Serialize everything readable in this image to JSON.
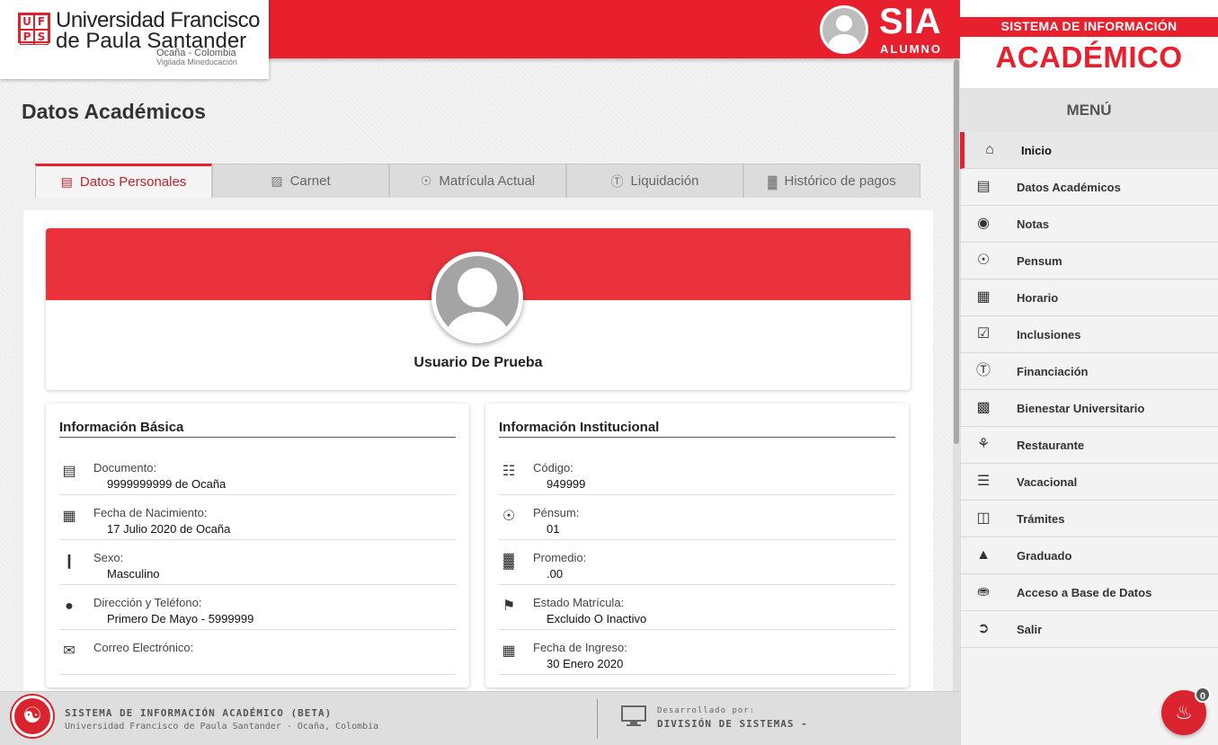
{
  "header": {
    "university_name_line1": "Universidad Francisco",
    "university_name_line2": "de Paula Santander",
    "university_city": "Ocaña - Colombia",
    "university_vigilance": "Vigilada Mineducación",
    "logo_letters": [
      "U",
      "F",
      "P",
      "S"
    ],
    "app_title": "SIA",
    "app_subtitle": "ALUMNO",
    "accent_color": "#e8202e"
  },
  "page": {
    "title": "Datos Académicos"
  },
  "tabs": [
    {
      "label": "Datos Personales",
      "icon": "id-card-icon"
    },
    {
      "label": "Carnet",
      "icon": "badge-icon"
    },
    {
      "label": "Matrícula Actual",
      "icon": "sitemap-icon"
    },
    {
      "label": "Liquidación",
      "icon": "dollar-icon"
    },
    {
      "label": "Histórico de pagos",
      "icon": "bar-chart-icon"
    }
  ],
  "profile": {
    "name": "Usuario De Prueba"
  },
  "basic_info": {
    "title": "Información Básica",
    "rows": [
      {
        "label": "Documento:",
        "value": "9999999999 de Ocaña",
        "icon": "credit-card-icon"
      },
      {
        "label": "Fecha de Nacimiento:",
        "value": "17 Julio 2020 de Ocaña",
        "icon": "calendar-icon"
      },
      {
        "label": "Sexo:",
        "value": "Masculino",
        "icon": "person-icon"
      },
      {
        "label": "Dirección y Teléfono:",
        "value": "Primero De Mayo - 5999999",
        "icon": "map-pin-icon"
      },
      {
        "label": "Correo Electrónico:",
        "value": "",
        "icon": "envelope-icon"
      }
    ]
  },
  "institutional_info": {
    "title": "Información Institucional",
    "rows": [
      {
        "label": "Código:",
        "value": "949999",
        "icon": "barcode-icon"
      },
      {
        "label": "Pénsum:",
        "value": "01",
        "icon": "sitemap-icon"
      },
      {
        "label": "Promedio:",
        "value": ".00",
        "icon": "bar-chart-icon"
      },
      {
        "label": "Estado Matrícula:",
        "value": "Excluido O Inactivo",
        "icon": "flag-icon"
      },
      {
        "label": "Fecha de Ingreso:",
        "value": "30 Enero 2020",
        "icon": "calendar-icon"
      }
    ]
  },
  "footer": {
    "system_name": "SISTEMA DE INFORMACIÓN ACADÉMICO (BETA)",
    "university_line": "Universidad Francisco de Paula Santander - Ocaña, Colombia",
    "developed_by_label": "Desarrollado por:",
    "developer": "DIVISIÓN DE SISTEMAS -"
  },
  "sidebar": {
    "title_small": "SISTEMA DE INFORMACIÓN",
    "title_big": "ACADÉMICO",
    "menu_header": "MENÚ",
    "items": [
      {
        "label": "Inicio",
        "icon": "home-icon"
      },
      {
        "label": "Datos Académicos",
        "icon": "credit-card-icon"
      },
      {
        "label": "Notas",
        "icon": "medal-icon"
      },
      {
        "label": "Pensum",
        "icon": "sitemap-icon"
      },
      {
        "label": "Horario",
        "icon": "calendar-icon"
      },
      {
        "label": "Inclusiones",
        "icon": "checkbox-icon"
      },
      {
        "label": "Financiación",
        "icon": "dollar-icon"
      },
      {
        "label": "Bienestar Universitario",
        "icon": "briefcase-icon"
      },
      {
        "label": "Restaurante",
        "icon": "cutlery-icon"
      },
      {
        "label": "Vacacional",
        "icon": "books-icon"
      },
      {
        "label": "Trámites",
        "icon": "folder-icon"
      },
      {
        "label": "Graduado",
        "icon": "graduation-cap-icon"
      },
      {
        "label": "Acceso a Base de Datos",
        "icon": "database-icon"
      },
      {
        "label": "Salir",
        "icon": "sign-out-icon"
      }
    ]
  },
  "notifications": {
    "count": "0",
    "icon": "bell-icon"
  }
}
